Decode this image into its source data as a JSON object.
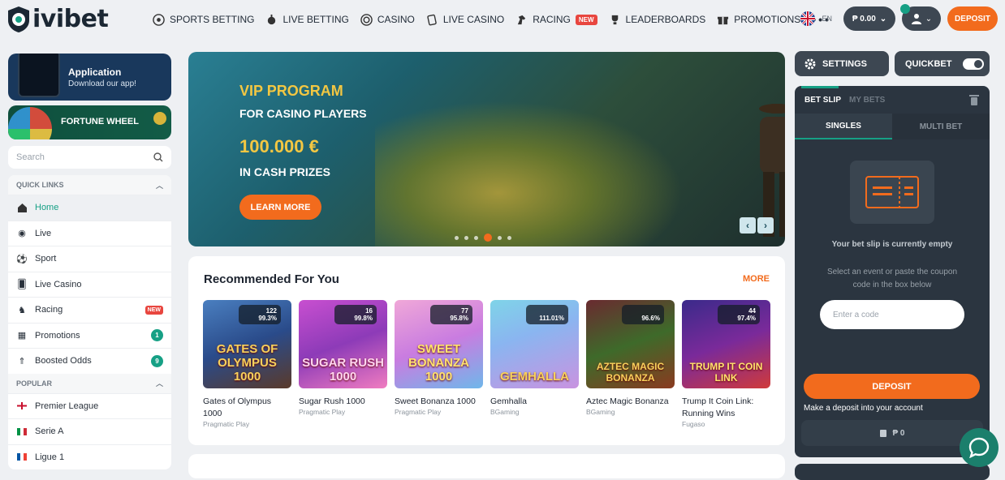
{
  "header": {
    "logo": "ivibet",
    "nav": [
      {
        "label": "SPORTS BETTING",
        "icon": "soccer-ball-icon"
      },
      {
        "label": "LIVE BETTING",
        "icon": "live-icon"
      },
      {
        "label": "CASINO",
        "icon": "casino-chip-icon"
      },
      {
        "label": "LIVE CASINO",
        "icon": "cards-icon"
      },
      {
        "label": "RACING",
        "icon": "horse-icon",
        "badge": "NEW"
      },
      {
        "label": "LEADERBOARDS",
        "icon": "trophy-icon"
      },
      {
        "label": "PROMOTIONS",
        "icon": "gift-icon"
      }
    ],
    "more": "•••",
    "lang": "EN",
    "balance": "₱ 0.00",
    "deposit": "DEPOSIT"
  },
  "sidebar": {
    "app_title": "Application",
    "app_sub": "Download our app!",
    "wheel": "FORTUNE WHEEL",
    "search_placeholder": "Search",
    "quick_links": "QUICK LINKS",
    "items": [
      {
        "label": "Home"
      },
      {
        "label": "Live"
      },
      {
        "label": "Sport"
      },
      {
        "label": "Live Casino"
      },
      {
        "label": "Racing",
        "badge": "NEW"
      },
      {
        "label": "Promotions",
        "count": "1"
      },
      {
        "label": "Boosted Odds",
        "count": "9"
      }
    ],
    "popular": "POPULAR",
    "leagues": [
      {
        "label": "Premier League"
      },
      {
        "label": "Serie A"
      },
      {
        "label": "Ligue 1"
      }
    ]
  },
  "banner": {
    "line1": "VIP PROGRAM",
    "line2": "FOR CASINO PLAYERS",
    "line3": "100.000 €",
    "line4": "IN CASH PRIZES",
    "button": "LEARN MORE"
  },
  "recommended": {
    "title": "Recommended For You",
    "more": "MORE",
    "games": [
      {
        "name": "Gates of Olympus 1000",
        "provider": "Pragmatic Play",
        "count": "122",
        "rtp": "99.3%",
        "art": "GATES OF OLYMPUS 1000"
      },
      {
        "name": "Sugar Rush 1000",
        "provider": "Pragmatic Play",
        "count": "16",
        "rtp": "99.8%",
        "art": "SUGAR RUSH 1000"
      },
      {
        "name": "Sweet Bonanza 1000",
        "provider": "Pragmatic Play",
        "count": "77",
        "rtp": "95.8%",
        "art": "SWEET BONANZA 1000"
      },
      {
        "name": "Gemhalla",
        "provider": "BGaming",
        "count": "",
        "rtp": "111.01%",
        "art": "GEMHALLA"
      },
      {
        "name": "Aztec Magic Bonanza",
        "provider": "BGaming",
        "count": "",
        "rtp": "96.6%",
        "art": "AZTEC MAGIC BONANZA"
      },
      {
        "name": "Trump It Coin Link: Running Wins",
        "provider": "Fugaso",
        "count": "44",
        "rtp": "97.4%",
        "art": "TRUMP IT COIN LINK"
      }
    ]
  },
  "betslip": {
    "settings": "SETTINGS",
    "quickbet": "QUICKBET",
    "tab_slip": "BET SLIP",
    "tab_mybets": "MY BETS",
    "singles": "SINGLES",
    "multi": "MULTI BET",
    "empty": "Your bet slip is currently empty",
    "hint": "Select an event or paste the coupon code in the box below",
    "code_placeholder": "Enter a code",
    "deposit": "DEPOSIT",
    "note": "Make a deposit into your account",
    "balance": "₱ 0"
  },
  "colors": {
    "accent": "#f26b1d",
    "green": "#16a085",
    "dark": "#2b3540"
  }
}
